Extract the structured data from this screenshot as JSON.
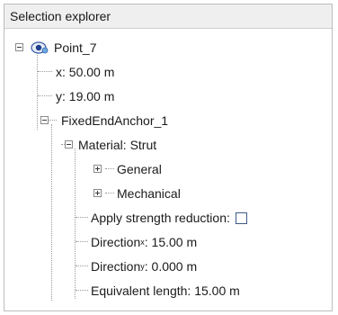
{
  "panel": {
    "title": "Selection explorer"
  },
  "tree": {
    "point": {
      "label": "Point_7",
      "icon": "eye-point-icon"
    },
    "x": {
      "text": "x: 50.00 m"
    },
    "y": {
      "text": "y: 19.00 m"
    },
    "anchor": {
      "label": "FixedEndAnchor_1"
    },
    "material": {
      "label": "Material: Strut"
    },
    "general": {
      "label": "General"
    },
    "mechanical": {
      "label": "Mechanical"
    },
    "apply_strength": {
      "label": "Apply strength reduction:",
      "checked": false
    },
    "direction_x": {
      "prefix": "Direction",
      "sub": "x",
      "value": ": 15.00 m"
    },
    "direction_y": {
      "prefix": "Direction",
      "sub": "y",
      "value": ": 0.000 m"
    },
    "equiv_length": {
      "text": "Equivalent length: 15.00 m"
    }
  }
}
